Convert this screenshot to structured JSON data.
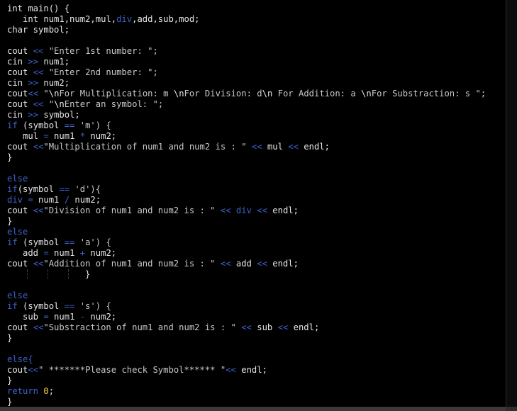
{
  "colors": {
    "background": "#000000",
    "text": "#e6e6e6",
    "operator": "#3f61c9",
    "string": "#c9c9c9",
    "number": "#ffd23f"
  },
  "code_lines": [
    [
      {
        "t": "int main() {",
        "c": "kw"
      }
    ],
    [
      {
        "t": "   int num1,num2,mul,",
        "c": "text"
      },
      {
        "t": "div",
        "c": "var"
      },
      {
        "t": ",add,sub,mod;",
        "c": "text"
      }
    ],
    [
      {
        "t": "char symbol;",
        "c": "text"
      }
    ],
    [],
    [
      {
        "t": "cout ",
        "c": "text"
      },
      {
        "t": "<<",
        "c": "op"
      },
      {
        "t": " \"Enter 1st number: \";",
        "c": "str"
      }
    ],
    [
      {
        "t": "cin ",
        "c": "text"
      },
      {
        "t": ">>",
        "c": "op"
      },
      {
        "t": " num1;",
        "c": "text"
      }
    ],
    [
      {
        "t": "cout ",
        "c": "text"
      },
      {
        "t": "<<",
        "c": "op"
      },
      {
        "t": " \"Enter 2nd number: \";",
        "c": "str"
      }
    ],
    [
      {
        "t": "cin ",
        "c": "text"
      },
      {
        "t": ">>",
        "c": "op"
      },
      {
        "t": " num2;",
        "c": "text"
      }
    ],
    [
      {
        "t": "cout",
        "c": "text"
      },
      {
        "t": "<<",
        "c": "op"
      },
      {
        "t": " \"",
        "c": "str"
      },
      {
        "t": "\\n",
        "c": "esc"
      },
      {
        "t": "For Multiplication: m ",
        "c": "str"
      },
      {
        "t": "\\n",
        "c": "esc"
      },
      {
        "t": "For Division: d",
        "c": "str"
      },
      {
        "t": "\\n",
        "c": "esc"
      },
      {
        "t": " For Addition: a ",
        "c": "str"
      },
      {
        "t": "\\n",
        "c": "esc"
      },
      {
        "t": "For Substraction: s \";",
        "c": "str"
      }
    ],
    [
      {
        "t": "cout ",
        "c": "text"
      },
      {
        "t": "<<",
        "c": "op"
      },
      {
        "t": " \"",
        "c": "str"
      },
      {
        "t": "\\n",
        "c": "esc"
      },
      {
        "t": "Enter an symbol: \";",
        "c": "str"
      }
    ],
    [
      {
        "t": "cin ",
        "c": "text"
      },
      {
        "t": ">>",
        "c": "op"
      },
      {
        "t": " symbol;",
        "c": "text"
      }
    ],
    [
      {
        "t": "if",
        "c": "ctl"
      },
      {
        "t": " (symbol ",
        "c": "text"
      },
      {
        "t": "==",
        "c": "op"
      },
      {
        "t": " 'm') {",
        "c": "str"
      }
    ],
    [
      {
        "t": "   mul ",
        "c": "text"
      },
      {
        "t": "=",
        "c": "op"
      },
      {
        "t": " num1 ",
        "c": "text"
      },
      {
        "t": "*",
        "c": "op"
      },
      {
        "t": " num2;",
        "c": "text"
      }
    ],
    [
      {
        "t": "cout ",
        "c": "text"
      },
      {
        "t": "<<",
        "c": "op"
      },
      {
        "t": "\"Multiplication of num1 and num2 is : \" ",
        "c": "str"
      },
      {
        "t": "<<",
        "c": "op"
      },
      {
        "t": " mul ",
        "c": "text"
      },
      {
        "t": "<<",
        "c": "op"
      },
      {
        "t": " endl;",
        "c": "text"
      }
    ],
    [
      {
        "t": "}",
        "c": "text"
      }
    ],
    [],
    [
      {
        "t": "else",
        "c": "ctl"
      }
    ],
    [
      {
        "t": "if",
        "c": "ctl"
      },
      {
        "t": "(symbol ",
        "c": "text"
      },
      {
        "t": "==",
        "c": "op"
      },
      {
        "t": " 'd'){",
        "c": "str"
      }
    ],
    [
      {
        "t": "div",
        "c": "var"
      },
      {
        "t": " ",
        "c": "text"
      },
      {
        "t": "=",
        "c": "op"
      },
      {
        "t": " num1 ",
        "c": "text"
      },
      {
        "t": "/",
        "c": "op"
      },
      {
        "t": " num2;",
        "c": "text"
      }
    ],
    [
      {
        "t": "cout ",
        "c": "text"
      },
      {
        "t": "<<",
        "c": "op"
      },
      {
        "t": "\"Division of num1 and num2 is : \" ",
        "c": "str"
      },
      {
        "t": "<<",
        "c": "op"
      },
      {
        "t": " ",
        "c": "text"
      },
      {
        "t": "div",
        "c": "var"
      },
      {
        "t": " ",
        "c": "text"
      },
      {
        "t": "<<",
        "c": "op"
      },
      {
        "t": " endl;",
        "c": "text"
      }
    ],
    [
      {
        "t": "}",
        "c": "text"
      }
    ],
    [
      {
        "t": "else",
        "c": "ctl"
      }
    ],
    [
      {
        "t": "if",
        "c": "ctl"
      },
      {
        "t": " (symbol ",
        "c": "text"
      },
      {
        "t": "==",
        "c": "op"
      },
      {
        "t": " 'a') {",
        "c": "str"
      }
    ],
    [
      {
        "t": "   add ",
        "c": "text"
      },
      {
        "t": "=",
        "c": "op"
      },
      {
        "t": " num1 ",
        "c": "text"
      },
      {
        "t": "+",
        "c": "op"
      },
      {
        "t": " num2;",
        "c": "text"
      }
    ],
    [
      {
        "t": "cout ",
        "c": "text"
      },
      {
        "t": "<<",
        "c": "op"
      },
      {
        "t": "\"Addition of num1 and num2 is : \" ",
        "c": "str"
      },
      {
        "t": "<<",
        "c": "op"
      },
      {
        "t": " add ",
        "c": "text"
      },
      {
        "t": "<<",
        "c": "op"
      },
      {
        "t": " endl;",
        "c": "text"
      }
    ],
    [
      {
        "t": "               }",
        "c": "text"
      }
    ],
    [],
    [
      {
        "t": "else",
        "c": "ctl"
      }
    ],
    [
      {
        "t": "if",
        "c": "ctl"
      },
      {
        "t": " (symbol ",
        "c": "text"
      },
      {
        "t": "==",
        "c": "op"
      },
      {
        "t": " 's') {",
        "c": "str"
      }
    ],
    [
      {
        "t": "   sub ",
        "c": "text"
      },
      {
        "t": "=",
        "c": "op"
      },
      {
        "t": " num1 ",
        "c": "text"
      },
      {
        "t": "-",
        "c": "op"
      },
      {
        "t": " num2;",
        "c": "text"
      }
    ],
    [
      {
        "t": "cout ",
        "c": "text"
      },
      {
        "t": "<<",
        "c": "op"
      },
      {
        "t": "\"Substraction of num1 and num2 is : \" ",
        "c": "str"
      },
      {
        "t": "<<",
        "c": "op"
      },
      {
        "t": " sub ",
        "c": "text"
      },
      {
        "t": "<<",
        "c": "op"
      },
      {
        "t": " endl;",
        "c": "text"
      }
    ],
    [
      {
        "t": "}",
        "c": "text"
      }
    ],
    [],
    [
      {
        "t": "else{",
        "c": "ctl"
      }
    ],
    [
      {
        "t": "cout",
        "c": "text"
      },
      {
        "t": "<<",
        "c": "op"
      },
      {
        "t": "\" *******Please check Symbol****** \"",
        "c": "str"
      },
      {
        "t": "<<",
        "c": "op"
      },
      {
        "t": " endl;",
        "c": "text"
      }
    ],
    [
      {
        "t": "}",
        "c": "text"
      }
    ],
    [
      {
        "t": "return",
        "c": "ctl"
      },
      {
        "t": " ",
        "c": "text"
      },
      {
        "t": "0",
        "c": "num"
      },
      {
        "t": ";",
        "c": "text"
      }
    ],
    [
      {
        "t": "}",
        "c": "text"
      }
    ]
  ]
}
